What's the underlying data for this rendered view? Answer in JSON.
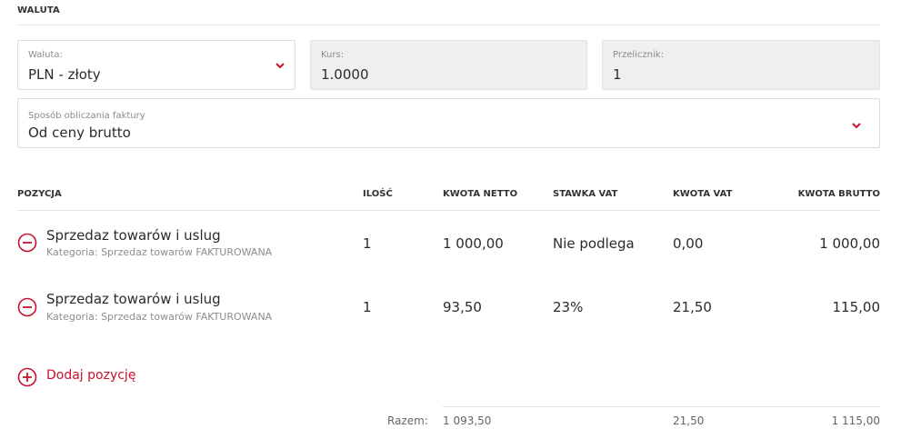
{
  "section": {
    "title": "WALUTA"
  },
  "currency": {
    "waluta_label": "Waluta:",
    "waluta_value": "PLN - złoty",
    "kurs_label": "Kurs:",
    "kurs_value": "1.0000",
    "przelicznik_label": "Przelicznik:",
    "przelicznik_value": "1",
    "method_label": "Sposób obliczania faktury",
    "method_value": "Od ceny brutto"
  },
  "table": {
    "headers": {
      "pozycja": "POZYCJA",
      "ilosc": "ILOŚĆ",
      "kwota_netto": "KWOTA NETTO",
      "stawka_vat": "STAWKA VAT",
      "kwota_vat": "KWOTA VAT",
      "kwota_brutto": "KWOTA BRUTTO"
    },
    "rows": [
      {
        "title": "Sprzedaz towarów i uslug",
        "category": "Kategoria: Sprzedaz towarów FAKTUROWANA",
        "ilosc": "1",
        "netto": "1 000,00",
        "stawka": "Nie podlega",
        "vat": "0,00",
        "brutto": "1 000,00"
      },
      {
        "title": "Sprzedaz towarów i uslug",
        "category": "Kategoria: Sprzedaz towarów FAKTUROWANA",
        "ilosc": "1",
        "netto": "93,50",
        "stawka": "23%",
        "vat": "21,50",
        "brutto": "115,00"
      }
    ],
    "add_label": "Dodaj pozycję",
    "summary": {
      "label": "Razem:",
      "netto": "1 093,50",
      "vat": "21,50",
      "brutto": "1 115,00"
    }
  },
  "colors": {
    "accent": "#c8102e",
    "readonly_bg": "#efefef",
    "border": "#dcdcdc"
  },
  "icons": {
    "dropdown": "chevron-down-icon",
    "remove": "minus-circle-icon",
    "add": "plus-circle-icon"
  }
}
